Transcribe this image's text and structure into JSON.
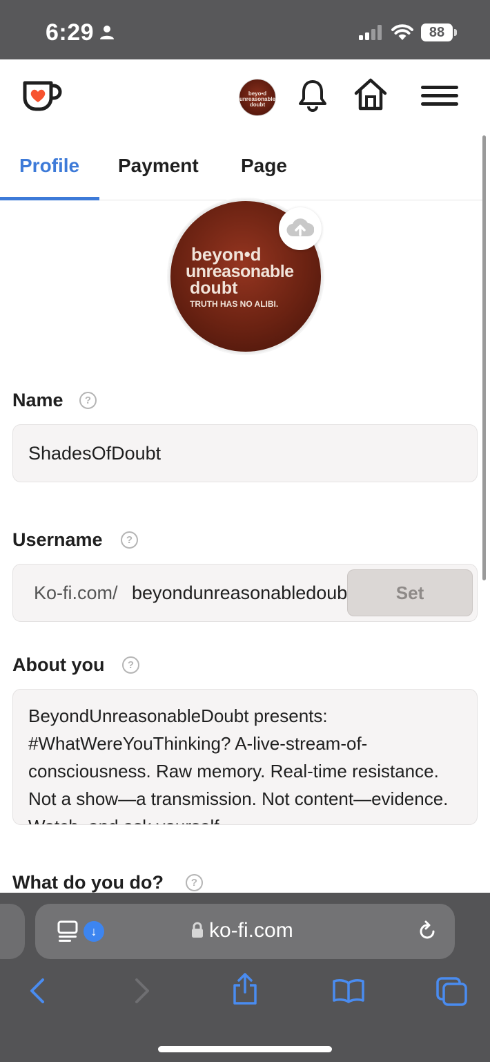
{
  "status_bar": {
    "time": "6:29",
    "battery": "88"
  },
  "tabs": [
    {
      "label": "Profile",
      "active": true
    },
    {
      "label": "Payment",
      "active": false
    },
    {
      "label": "Page",
      "active": false
    }
  ],
  "avatar": {
    "line1": "beyon•d",
    "line2": "unreasonable",
    "line3": "doubt",
    "tagline": "TRUTH HAS NO ALIBI."
  },
  "form": {
    "name_label": "Name",
    "name_value": "ShadesOfDoubt",
    "username_label": "Username",
    "username_prefix": "Ko-fi.com/",
    "username_value": "beyondunreasonabledoubt",
    "set_button": "Set",
    "about_label": "About you",
    "about_value": "BeyondUnreasonableDoubt presents: #WhatWereYouThinking? A-live-stream-of-consciousness. Raw memory. Real-time resistance. Not a show—a transmission. Not content—evidence. Watch, and ask yourself",
    "what_label": "What do you do?",
    "help_glyph": "?"
  },
  "browser": {
    "url": "ko-fi.com",
    "download_glyph": "↓"
  },
  "colors": {
    "accent": "#3d7ad8",
    "kofi_heart": "#f7532f",
    "avatar_bg": "#6a2212"
  }
}
